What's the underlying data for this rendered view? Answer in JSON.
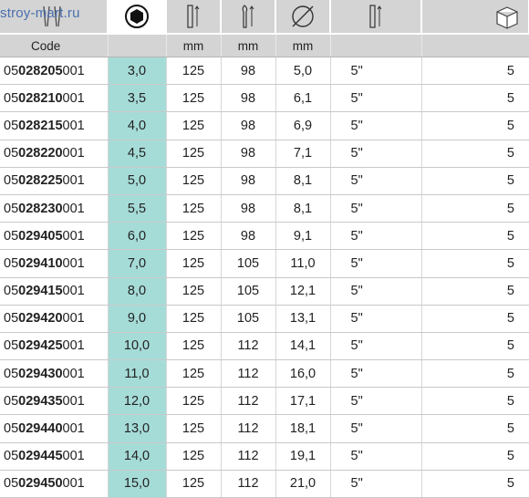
{
  "watermark": "stroy-mart.ru",
  "icons": [
    "screwdrivers-icon",
    "hex-socket-icon",
    "blade-length-icon",
    "total-length-icon",
    "diameter-icon",
    "drive-length-icon",
    "package-box-icon"
  ],
  "headers": {
    "code": "Code",
    "c2": "",
    "c3": "mm",
    "c4": "mm",
    "c5": "mm",
    "c6": "",
    "c7": ""
  },
  "accent_color": "#a6dcd8",
  "rows": [
    {
      "pre": "05",
      "mid": "028205",
      "suf": "001",
      "size": "3,0",
      "l1": "125",
      "l2": "98",
      "d": "5,0",
      "drive": "5\"",
      "qty": "5"
    },
    {
      "pre": "05",
      "mid": "028210",
      "suf": "001",
      "size": "3,5",
      "l1": "125",
      "l2": "98",
      "d": "6,1",
      "drive": "5\"",
      "qty": "5"
    },
    {
      "pre": "05",
      "mid": "028215",
      "suf": "001",
      "size": "4,0",
      "l1": "125",
      "l2": "98",
      "d": "6,9",
      "drive": "5\"",
      "qty": "5"
    },
    {
      "pre": "05",
      "mid": "028220",
      "suf": "001",
      "size": "4,5",
      "l1": "125",
      "l2": "98",
      "d": "7,1",
      "drive": "5\"",
      "qty": "5"
    },
    {
      "pre": "05",
      "mid": "028225",
      "suf": "001",
      "size": "5,0",
      "l1": "125",
      "l2": "98",
      "d": "8,1",
      "drive": "5\"",
      "qty": "5"
    },
    {
      "pre": "05",
      "mid": "028230",
      "suf": "001",
      "size": "5,5",
      "l1": "125",
      "l2": "98",
      "d": "8,1",
      "drive": "5\"",
      "qty": "5"
    },
    {
      "pre": "05",
      "mid": "029405",
      "suf": "001",
      "size": "6,0",
      "l1": "125",
      "l2": "98",
      "d": "9,1",
      "drive": "5\"",
      "qty": "5"
    },
    {
      "pre": "05",
      "mid": "029410",
      "suf": "001",
      "size": "7,0",
      "l1": "125",
      "l2": "105",
      "d": "11,0",
      "drive": "5\"",
      "qty": "5"
    },
    {
      "pre": "05",
      "mid": "029415",
      "suf": "001",
      "size": "8,0",
      "l1": "125",
      "l2": "105",
      "d": "12,1",
      "drive": "5\"",
      "qty": "5"
    },
    {
      "pre": "05",
      "mid": "029420",
      "suf": "001",
      "size": "9,0",
      "l1": "125",
      "l2": "105",
      "d": "13,1",
      "drive": "5\"",
      "qty": "5"
    },
    {
      "pre": "05",
      "mid": "029425",
      "suf": "001",
      "size": "10,0",
      "l1": "125",
      "l2": "112",
      "d": "14,1",
      "drive": "5\"",
      "qty": "5"
    },
    {
      "pre": "05",
      "mid": "029430",
      "suf": "001",
      "size": "11,0",
      "l1": "125",
      "l2": "112",
      "d": "16,0",
      "drive": "5\"",
      "qty": "5"
    },
    {
      "pre": "05",
      "mid": "029435",
      "suf": "001",
      "size": "12,0",
      "l1": "125",
      "l2": "112",
      "d": "17,1",
      "drive": "5\"",
      "qty": "5"
    },
    {
      "pre": "05",
      "mid": "029440",
      "suf": "001",
      "size": "13,0",
      "l1": "125",
      "l2": "112",
      "d": "18,1",
      "drive": "5\"",
      "qty": "5"
    },
    {
      "pre": "05",
      "mid": "029445",
      "suf": "001",
      "size": "14,0",
      "l1": "125",
      "l2": "112",
      "d": "19,1",
      "drive": "5\"",
      "qty": "5"
    },
    {
      "pre": "05",
      "mid": "029450",
      "suf": "001",
      "size": "15,0",
      "l1": "125",
      "l2": "112",
      "d": "21,0",
      "drive": "5\"",
      "qty": "5"
    }
  ]
}
